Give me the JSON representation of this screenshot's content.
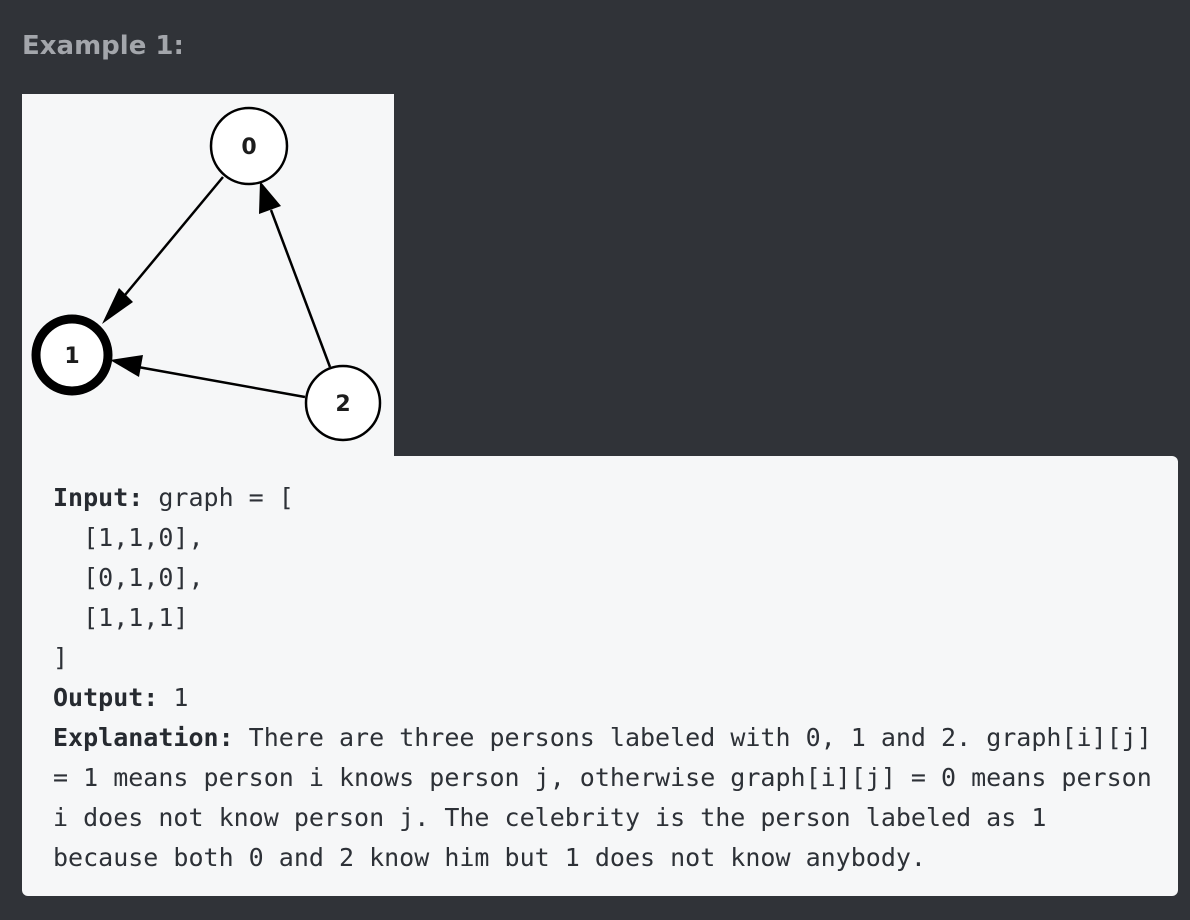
{
  "heading": "Example 1:",
  "graph": {
    "nodes": [
      {
        "label": "0",
        "id": 0
      },
      {
        "label": "1",
        "id": 1
      },
      {
        "label": "2",
        "id": 2
      }
    ],
    "edges": [
      {
        "from": 0,
        "to": 1
      },
      {
        "from": 2,
        "to": 0
      },
      {
        "from": 2,
        "to": 1
      }
    ],
    "celebrity": 1
  },
  "example": {
    "input_label": "Input:",
    "input_lines": [
      " graph = [",
      "  [1,1,0],",
      "  [0,1,0],",
      "  [1,1,1]",
      "]"
    ],
    "output_label": "Output:",
    "output_value": " 1",
    "explanation_label": "Explanation:",
    "explanation_text": " There are three persons labeled with 0, 1 and 2. graph[i][j] = 1 means person i knows person j, otherwise graph[i][j] = 0 means person i does not know person j. The celebrity is the person labeled as 1 because both 0 and 2 know him but 1 does not know anybody."
  }
}
